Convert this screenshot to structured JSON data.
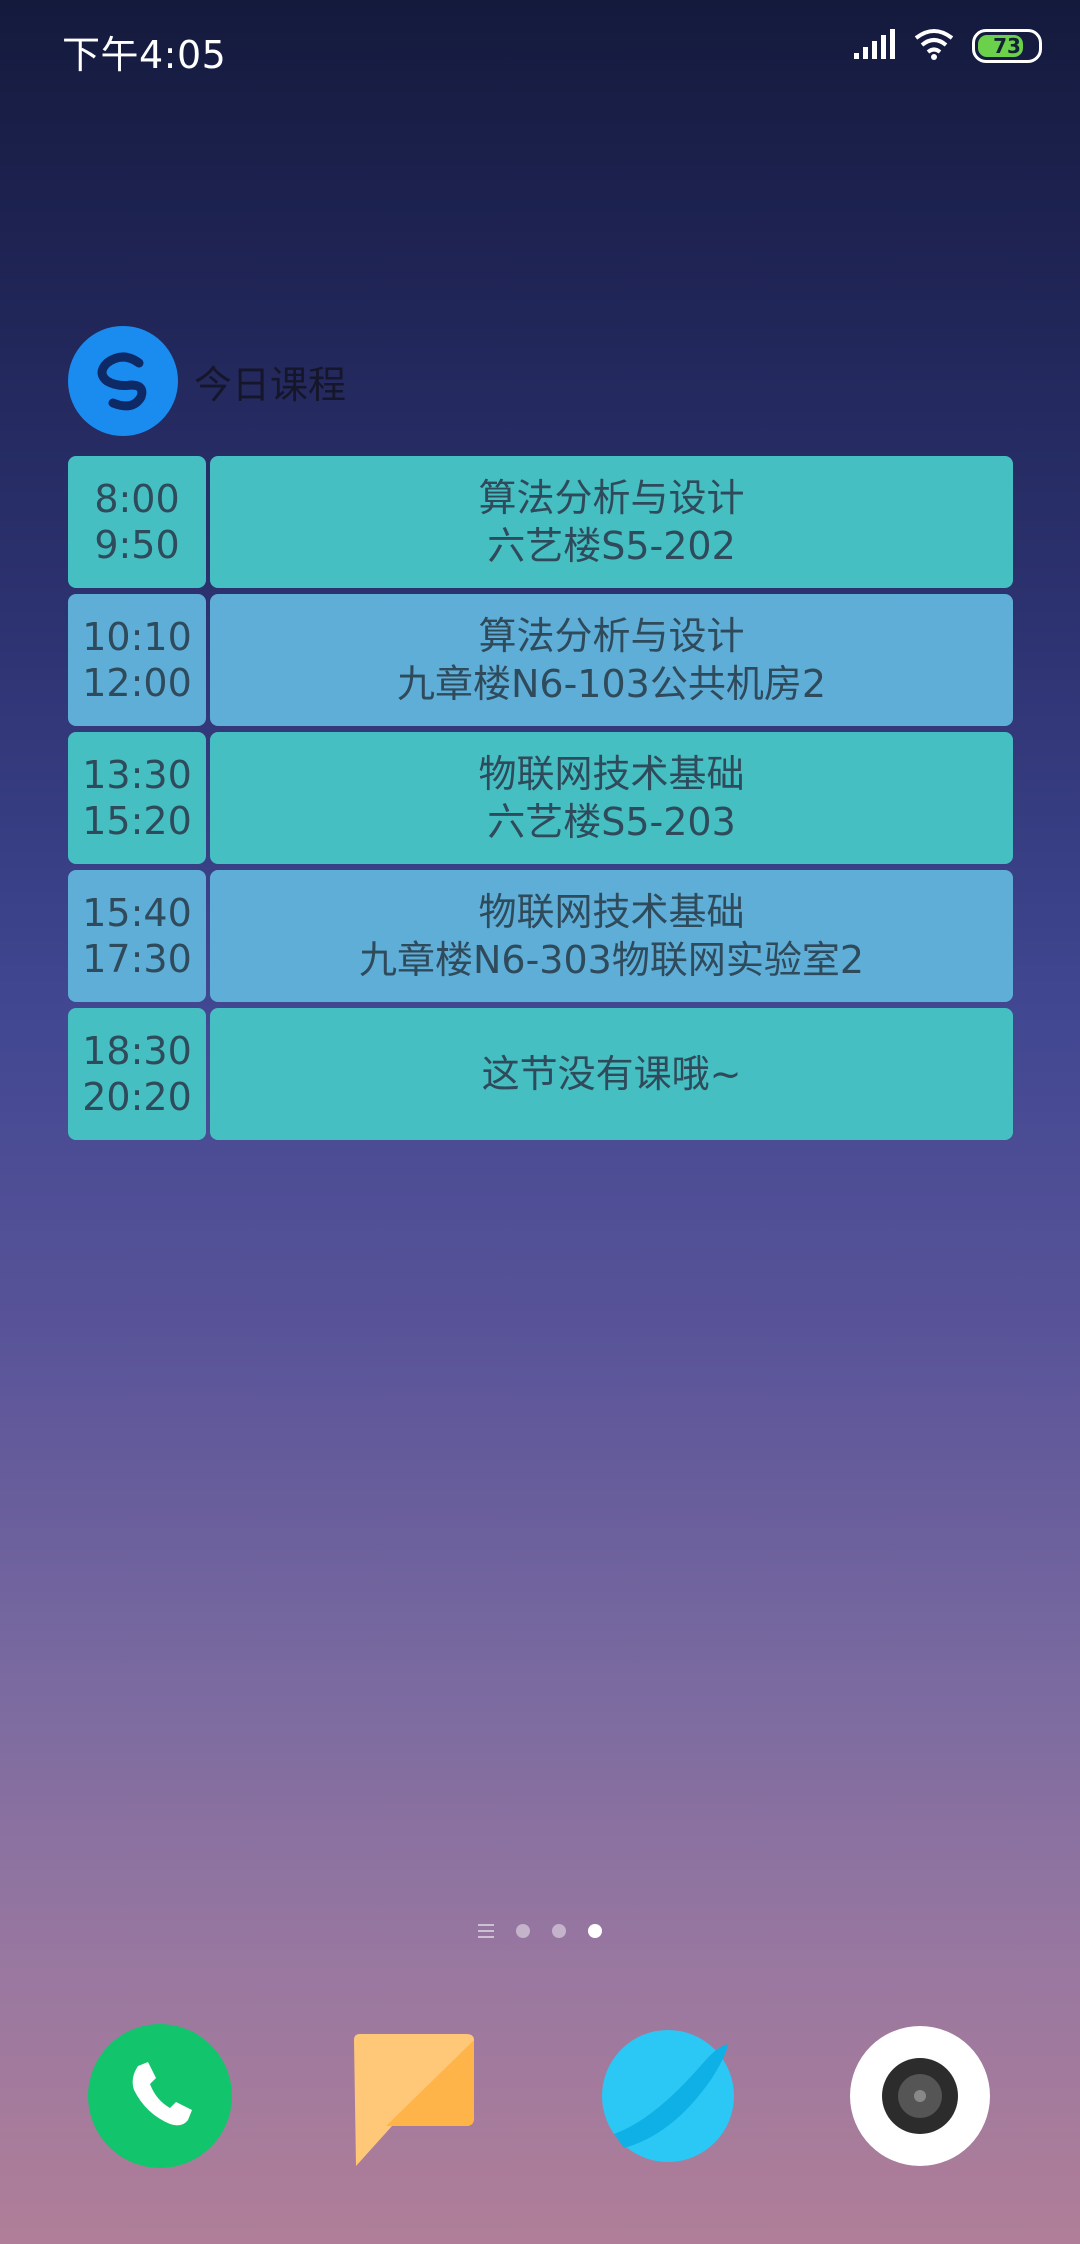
{
  "status_bar": {
    "time": "下午4:05",
    "battery_level": "73",
    "icons": [
      "signal-icon",
      "wifi-icon",
      "battery-icon"
    ]
  },
  "widget": {
    "title": "今日课程",
    "rows": [
      {
        "start": "8:00",
        "end": "9:50",
        "course": "算法分析与设计",
        "location": "六艺楼S5-202",
        "color": "teal"
      },
      {
        "start": "10:10",
        "end": "12:00",
        "course": "算法分析与设计",
        "location": "九章楼N6-103公共机房2",
        "color": "blue"
      },
      {
        "start": "13:30",
        "end": "15:20",
        "course": "物联网技术基础",
        "location": "六艺楼S5-203",
        "color": "teal"
      },
      {
        "start": "15:40",
        "end": "17:30",
        "course": "物联网技术基础",
        "location": "九章楼N6-303物联网实验室2",
        "color": "blue"
      },
      {
        "start": "18:30",
        "end": "20:20",
        "course": "这节没有课哦~",
        "location": "",
        "color": "teal"
      }
    ]
  },
  "pager": {
    "pages": 3,
    "active_index": 2
  },
  "dock": {
    "apps": [
      "phone-icon",
      "messages-icon",
      "browser-icon",
      "camera-icon"
    ]
  },
  "colors": {
    "teal": "#45bfc2",
    "blue": "#5eaed8",
    "logo": "#1a8cf0",
    "phone": "#12c46b",
    "browser": "#2bc7f5"
  }
}
